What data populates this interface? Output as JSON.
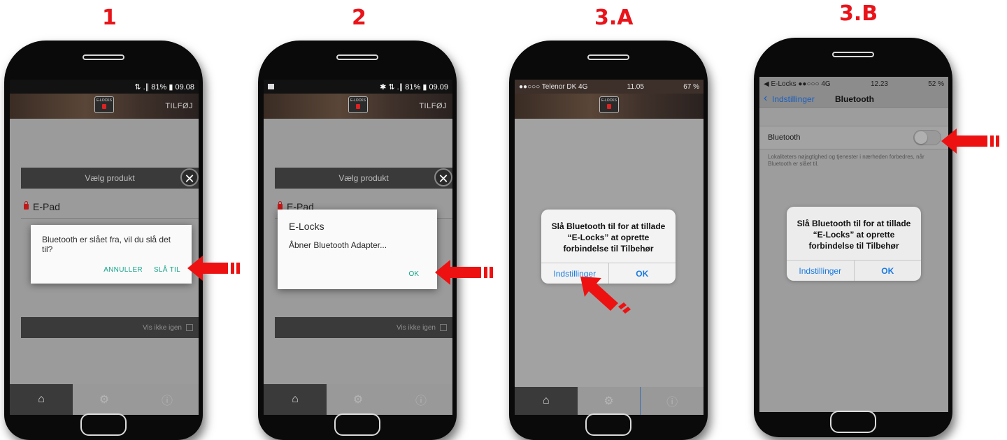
{
  "steps": [
    "1",
    "2",
    "3.A",
    "3.B"
  ],
  "colors": {
    "accent_red": "#e8141a",
    "android_teal": "#15a38a",
    "ios_blue": "#1a7ae0"
  },
  "phone1": {
    "status": "⇅ .∥ 81% ▮ 09.08",
    "header_action": "TILFØJ",
    "select_product": "Vælg produkt",
    "product": "E-Pad",
    "dialog_message": "Bluetooth er slået fra, vil du slå det til?",
    "btn_cancel": "ANNULLER",
    "btn_enable": "SLÅ TIL",
    "dont_show": "Vis ikke igen"
  },
  "phone2": {
    "status": "✱ ⇅ .∥ 81% ▮ 09.09",
    "header_action": "TILFØJ",
    "select_product": "Vælg produkt",
    "product": "E-Pad",
    "dialog_title": "E-Locks",
    "dialog_message": "Åbner Bluetooth Adapter...",
    "btn_ok": "OK",
    "dont_show": "Vis ikke igen"
  },
  "phone3a": {
    "status_left": "●●○○○ Telenor DK  4G",
    "status_time": "11.05",
    "status_right": "67 %",
    "dialog_message": "Slå Bluetooth til for at tillade “E-Locks” at oprette forbindelse til Tilbehør",
    "btn_settings": "Indstillinger",
    "btn_ok": "OK"
  },
  "phone3b": {
    "status_left": "◀ E-Locks ●●○○○ 4G",
    "status_time": "12.23",
    "status_right": "52 %",
    "back_label": "Indstillinger",
    "nav_title": "Bluetooth",
    "row_label": "Bluetooth",
    "toggle_on": false,
    "footnote": "Lokaliteters nøjagtighed og tjenester i nærheden forbedres, når Bluetooth er slået til.",
    "dialog_message": "Slå Bluetooth til for at tillade “E-Locks” at oprette forbindelse til Tilbehør",
    "btn_settings": "Indstillinger",
    "btn_ok": "OK"
  },
  "icons": [
    "home-icon",
    "gear-icon",
    "info-icon",
    "close-icon",
    "lock-icon",
    "red-arrow-icon",
    "chevron-left-icon"
  ]
}
